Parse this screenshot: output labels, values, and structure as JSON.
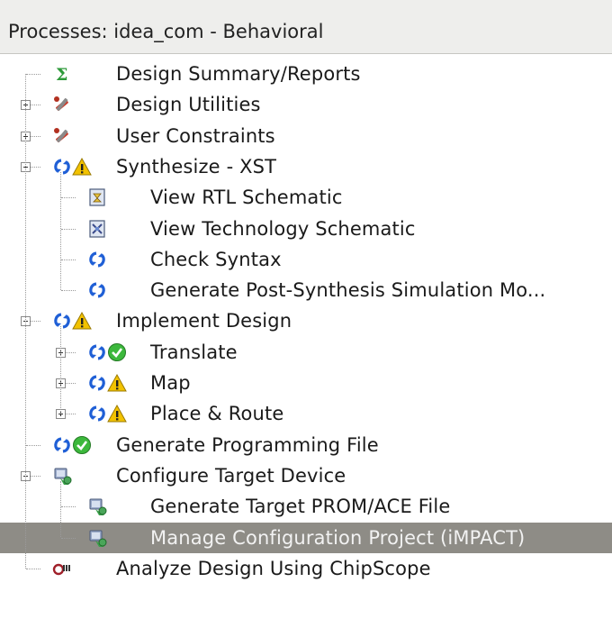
{
  "panel": {
    "title": "Processes: idea_com - Behavioral"
  },
  "tree": [
    {
      "label": "Design Summary/Reports",
      "icons": [
        "sigma-icon"
      ],
      "expander": null,
      "depth": 0
    },
    {
      "label": "Design Utilities",
      "icons": [
        "tools-icon"
      ],
      "expander": "plus",
      "depth": 0
    },
    {
      "label": "User Constraints",
      "icons": [
        "tools-icon"
      ],
      "expander": "plus",
      "depth": 0
    },
    {
      "label": "Synthesize - XST",
      "icons": [
        "refresh-icon",
        "warning-icon"
      ],
      "expander": "minus",
      "depth": 0
    },
    {
      "label": "View RTL Schematic",
      "icons": [
        "schematic-icon"
      ],
      "expander": null,
      "depth": 1
    },
    {
      "label": "View Technology Schematic",
      "icons": [
        "tech-schematic-icon"
      ],
      "expander": null,
      "depth": 1
    },
    {
      "label": "Check Syntax",
      "icons": [
        "refresh-icon"
      ],
      "expander": null,
      "depth": 1
    },
    {
      "label": "Generate Post-Synthesis Simulation Mo...",
      "icons": [
        "refresh-icon"
      ],
      "expander": null,
      "depth": 1
    },
    {
      "label": "Implement Design",
      "icons": [
        "refresh-icon",
        "warning-icon"
      ],
      "expander": "minus",
      "depth": 0
    },
    {
      "label": "Translate",
      "icons": [
        "refresh-icon",
        "check-icon"
      ],
      "expander": "plus",
      "depth": 1
    },
    {
      "label": "Map",
      "icons": [
        "refresh-icon",
        "warning-icon"
      ],
      "expander": "plus",
      "depth": 1
    },
    {
      "label": "Place & Route",
      "icons": [
        "refresh-icon",
        "warning-icon"
      ],
      "expander": "plus",
      "depth": 1
    },
    {
      "label": "Generate Programming File",
      "icons": [
        "refresh-icon",
        "check-icon"
      ],
      "expander": null,
      "depth": 0
    },
    {
      "label": "Configure Target Device",
      "icons": [
        "device-icon"
      ],
      "expander": "minus",
      "depth": 0
    },
    {
      "label": "Generate Target PROM/ACE File",
      "icons": [
        "device-icon"
      ],
      "expander": null,
      "depth": 1
    },
    {
      "label": "Manage Configuration Project (iMPACT)",
      "icons": [
        "device-icon"
      ],
      "expander": null,
      "depth": 1,
      "selected": true
    },
    {
      "label": "Analyze Design Using ChipScope",
      "icons": [
        "chipscope-icon"
      ],
      "expander": null,
      "depth": 0
    }
  ],
  "colors": {
    "selection": "#8e8c86",
    "refresh": "#1f5fd6",
    "warning": "#f2c200",
    "success": "#3cb83c"
  }
}
